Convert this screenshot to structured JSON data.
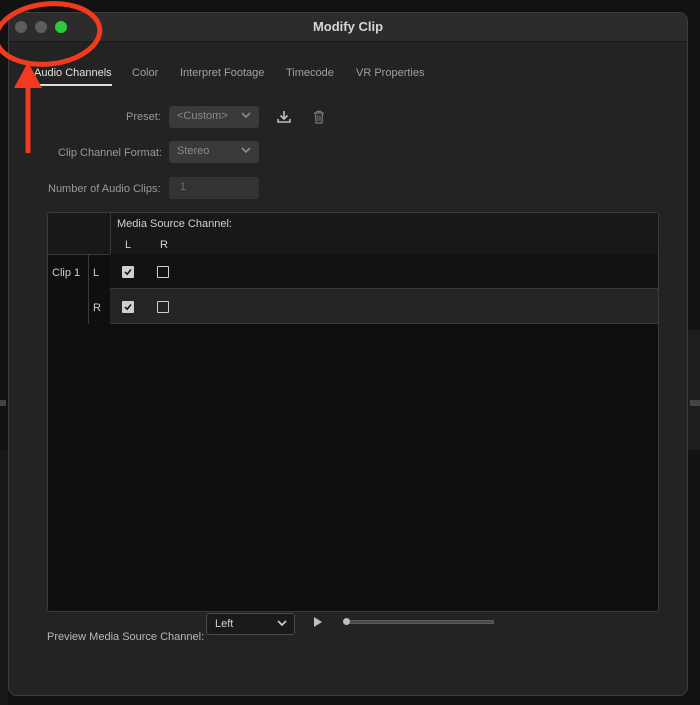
{
  "window": {
    "title": "Modify Clip",
    "traffic_lights": [
      {
        "name": "close",
        "color": "#5d5d5d"
      },
      {
        "name": "minimize",
        "color": "#5d5d5d"
      },
      {
        "name": "zoom",
        "color": "#2bc840"
      }
    ]
  },
  "tabs": [
    {
      "label": "Audio Channels",
      "active": true
    },
    {
      "label": "Color",
      "active": false
    },
    {
      "label": "Interpret Footage",
      "active": false
    },
    {
      "label": "Timecode",
      "active": false
    },
    {
      "label": "VR Properties",
      "active": false
    }
  ],
  "preset": {
    "label": "Preset:",
    "value": "<Custom>",
    "save_icon": "download-icon",
    "delete_icon": "trash-icon"
  },
  "channel_format": {
    "label": "Clip Channel Format:",
    "value": "Stereo"
  },
  "audio_clips": {
    "label": "Number of Audio Clips:",
    "value": "1"
  },
  "grid": {
    "header": "Media Source Channel:",
    "source_channels": [
      "L",
      "R"
    ],
    "clip_label": "Clip 1",
    "rows": [
      {
        "channel": "L",
        "checks": [
          true,
          false
        ]
      },
      {
        "channel": "R",
        "checks": [
          true,
          false
        ]
      }
    ]
  },
  "preview": {
    "label": "Preview Media Source Channel:",
    "value": "Left",
    "play_icon": "play-icon",
    "progress": 0.0
  },
  "colors": {
    "annotation": "#f23a1f",
    "accent": "#e0e0e0"
  }
}
